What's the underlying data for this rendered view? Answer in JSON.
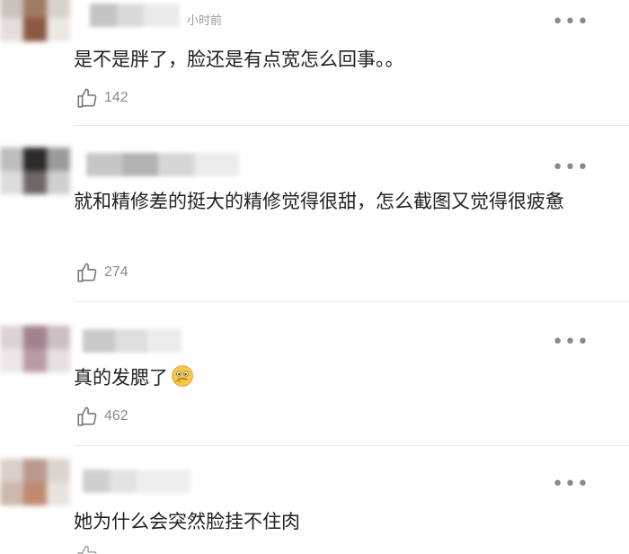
{
  "comments": [
    {
      "time": "小时前",
      "text": "是不是胖了，脸还是有点宽怎么回事。。",
      "likes": "142"
    },
    {
      "time": "",
      "text": "就和精修差的挺大的精修觉得很甜，怎么截图又觉得很疲惫",
      "likes": "274"
    },
    {
      "time": "",
      "text": "真的发腮了",
      "likes": "462"
    },
    {
      "time": "",
      "text": "她为什么会突然脸挂不住肉",
      "likes": ""
    }
  ],
  "icons": {
    "more": "more-icon",
    "like": "thumbs-up-icon",
    "emoji": "thinking-emoji-icon"
  },
  "colors": {
    "text": "#222222",
    "meta": "#9a9a9a",
    "divider": "#e8e8e8"
  }
}
